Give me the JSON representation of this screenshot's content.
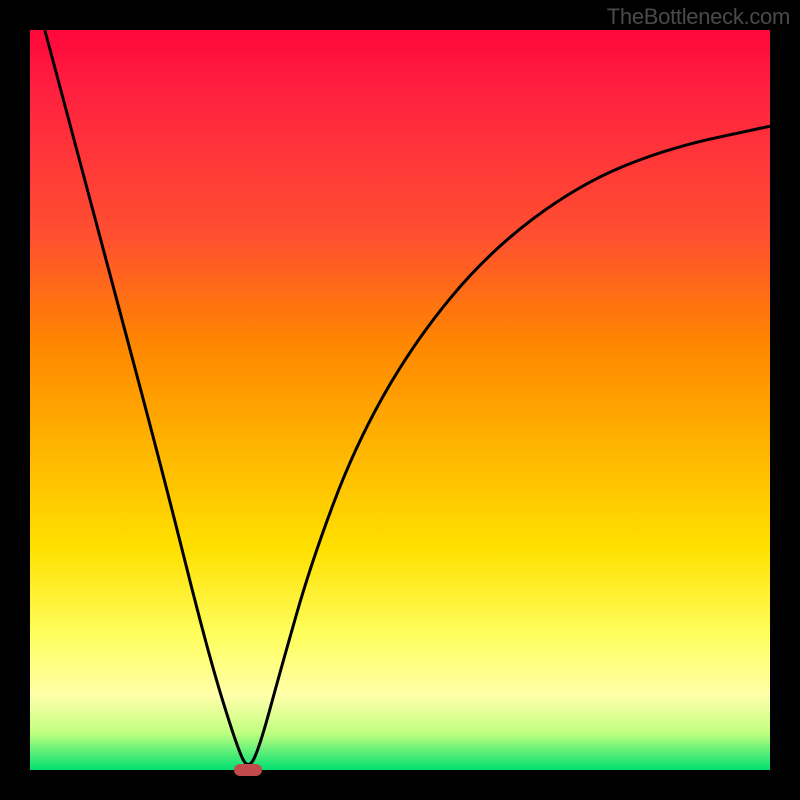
{
  "watermark": "TheBottleneck.com",
  "chart_data": {
    "type": "line",
    "title": "",
    "xlabel": "",
    "ylabel": "",
    "xlim": [
      0,
      100
    ],
    "ylim": [
      0,
      100
    ],
    "grid": false,
    "legend": false,
    "series": [
      {
        "name": "bottleneck-curve",
        "x": [
          2,
          10,
          18,
          24,
          28,
          29.5,
          31,
          34,
          38,
          44,
          52,
          62,
          74,
          86,
          100
        ],
        "y": [
          100,
          70,
          40,
          16,
          3,
          0,
          3,
          14,
          28,
          44,
          58,
          70,
          79,
          84,
          87
        ]
      }
    ],
    "minimum_marker": {
      "x": 29.5,
      "y": 0
    },
    "background": "rainbow-vertical-gradient",
    "colors": {
      "top": "#ff073a",
      "mid": "#ffe000",
      "bottom": "#00e070",
      "curve": "#000000",
      "marker": "#c24a4a"
    }
  }
}
